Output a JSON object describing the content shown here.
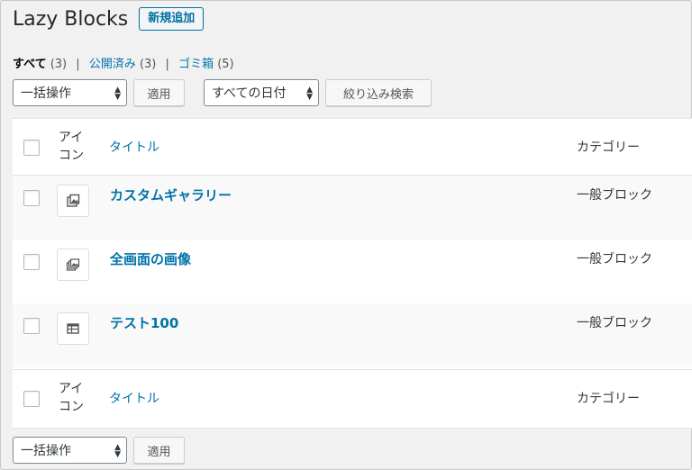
{
  "header": {
    "title": "Lazy Blocks",
    "add_new_label": "新規追加"
  },
  "filters": {
    "all_label": "すべて",
    "all_count": "(3)",
    "published_label": "公開済み",
    "published_count": "(3)",
    "trash_label": "ゴミ箱",
    "trash_count": "(5)",
    "separator": "|"
  },
  "tablenav_top": {
    "bulk_action": "一括操作",
    "apply_label": "適用",
    "date_filter": "すべての日付",
    "filter_label": "絞り込み検索"
  },
  "table": {
    "columns": {
      "icon": "アイコン",
      "title": "タイトル",
      "category": "カテゴリー"
    },
    "rows": [
      {
        "title": "カスタムギャラリー",
        "category": "一般ブロック",
        "icon": "gallery-icon"
      },
      {
        "title": "全画面の画像",
        "category": "一般ブロック",
        "icon": "images-icon"
      },
      {
        "title": "テスト100",
        "category": "一般ブロック",
        "icon": "table-icon"
      }
    ]
  },
  "tablenav_bottom": {
    "bulk_action": "一括操作",
    "apply_label": "適用"
  },
  "colors": {
    "link": "#0073aa",
    "background": "#f1f1f1",
    "alt_row": "#f9f9f9"
  }
}
